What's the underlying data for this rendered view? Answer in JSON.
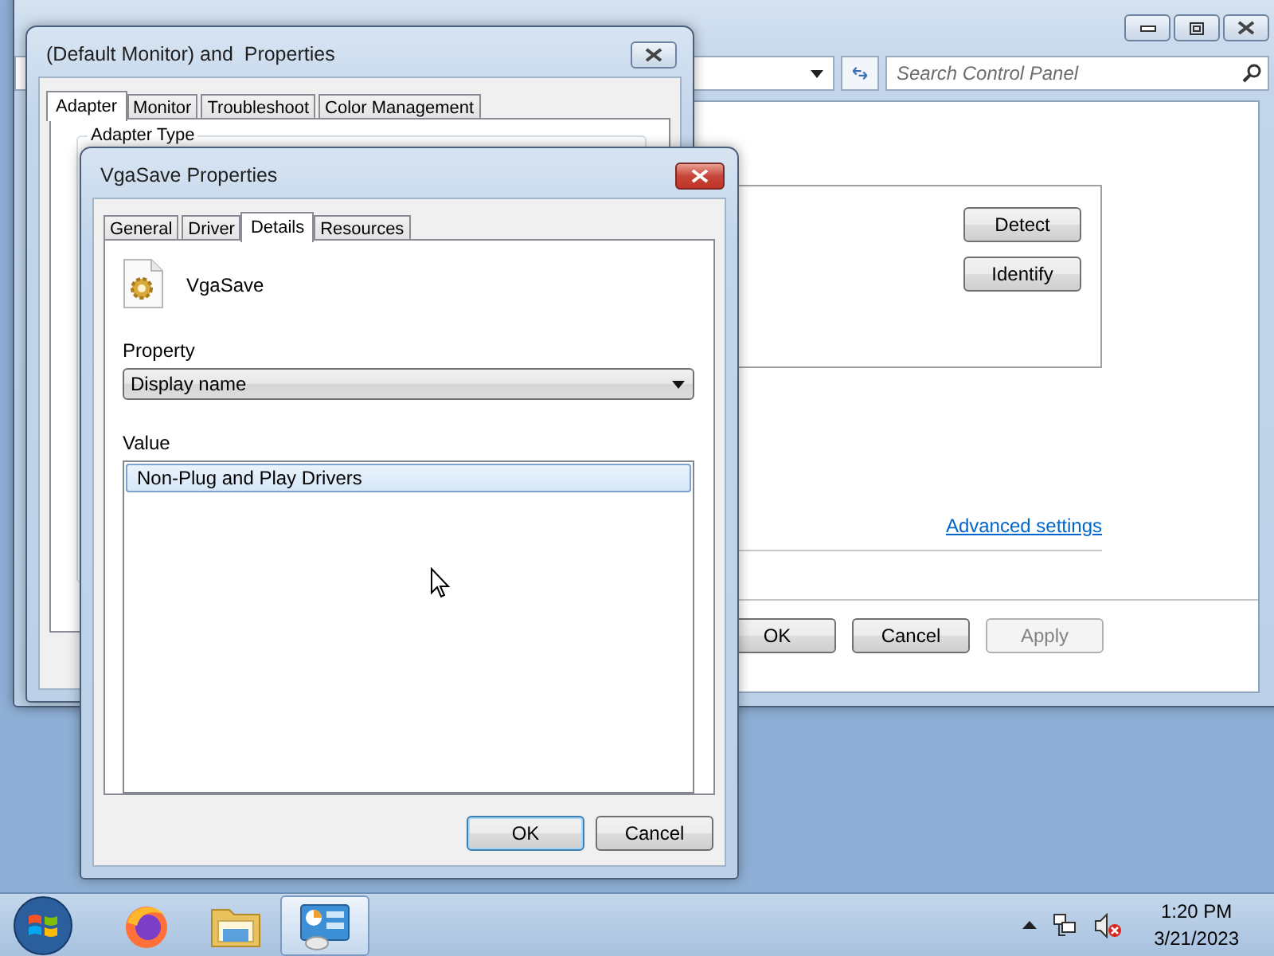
{
  "control_panel": {
    "search": {
      "placeholder": "Search Control Panel"
    },
    "side_buttons": [
      {
        "label": "Detect"
      },
      {
        "label": "Identify"
      }
    ],
    "link": "Advanced settings",
    "dialog_buttons": [
      {
        "label": "OK",
        "disabled": false
      },
      {
        "label": "Cancel",
        "disabled": false
      },
      {
        "label": "Apply",
        "disabled": true
      }
    ]
  },
  "monitor_dialog": {
    "title": "(Default Monitor) and  Properties",
    "tabs": [
      {
        "label": "Adapter",
        "selected": true
      },
      {
        "label": "Monitor",
        "selected": false
      },
      {
        "label": "Troubleshoot",
        "selected": false
      },
      {
        "label": "Color Management",
        "selected": false
      }
    ],
    "group_label": "Adapter Type"
  },
  "device_dialog": {
    "title": "VgaSave Properties",
    "tabs": [
      {
        "label": "General",
        "selected": false
      },
      {
        "label": "Driver",
        "selected": false
      },
      {
        "label": "Details",
        "selected": true
      },
      {
        "label": "Resources",
        "selected": false
      }
    ],
    "device_name": "VgaSave",
    "property_label": "Property",
    "property_value": "Display name",
    "value_label": "Value",
    "values": [
      {
        "text": "Non-Plug and Play Drivers",
        "selected": true
      }
    ],
    "buttons": [
      {
        "label": "OK",
        "default": true
      },
      {
        "label": "Cancel",
        "default": false
      }
    ]
  },
  "taskbar": {
    "apps": [
      {
        "kind": "firefox",
        "active": false
      },
      {
        "kind": "explorer",
        "active": false
      },
      {
        "kind": "control-panel",
        "active": true
      }
    ],
    "clock": {
      "time": "1:20 PM",
      "date": "3/21/2023"
    }
  }
}
